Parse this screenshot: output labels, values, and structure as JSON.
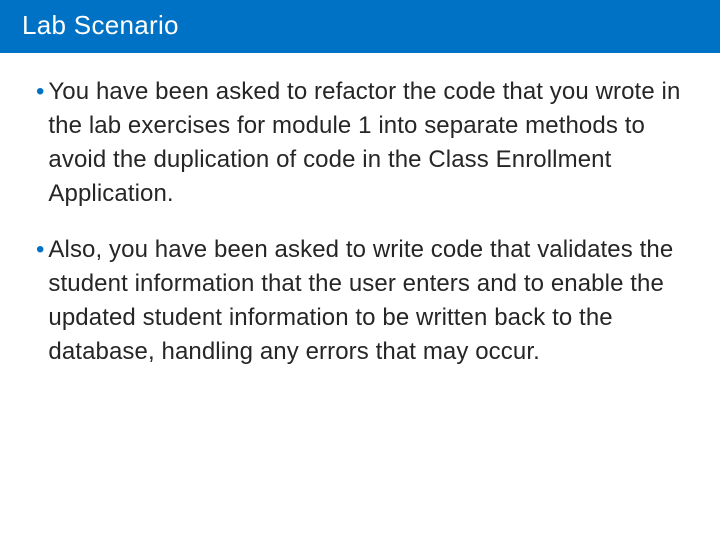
{
  "title": "Lab Scenario",
  "bullets": [
    "You have been asked to refactor the code that you wrote in the lab exercises for module 1 into separate methods to avoid the duplication of code in the Class Enrollment Application.",
    "Also, you have been asked to write code that validates the student information that the user enters and to enable the updated student information to be written back to the database, handling any errors that may occur."
  ],
  "colors": {
    "accent": "#0072c6"
  }
}
